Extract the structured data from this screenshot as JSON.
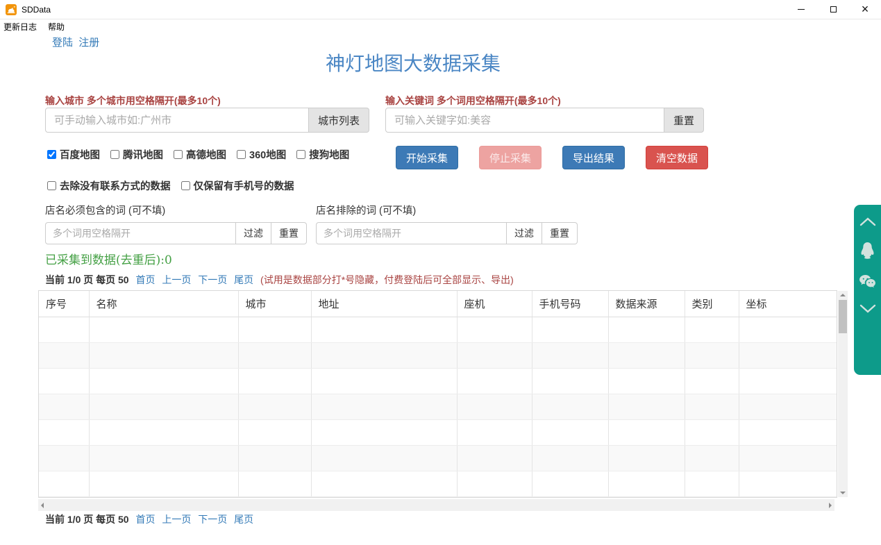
{
  "window": {
    "title": "SDData",
    "menu": [
      "更新日志",
      "帮助"
    ]
  },
  "auth": {
    "login": "登陆",
    "register": "注册"
  },
  "app": {
    "title": "神灯地图大数据采集"
  },
  "city_section": {
    "label": "输入城市 多个城市用空格隔开(最多10个)",
    "placeholder": "可手动输入城市如:广州市",
    "list_button": "城市列表"
  },
  "keyword_section": {
    "label": "输入关键词 多个词用空格隔开(最多10个)",
    "placeholder": "可输入关键字如:美容",
    "reset_button": "重置"
  },
  "map_sources": [
    {
      "label": "百度地图",
      "checked": true
    },
    {
      "label": "腾讯地图",
      "checked": false
    },
    {
      "label": "高德地图",
      "checked": false
    },
    {
      "label": "360地图",
      "checked": false
    },
    {
      "label": "搜狗地图",
      "checked": false
    }
  ],
  "actions": {
    "start": "开始采集",
    "stop": "停止采集",
    "export": "导出结果",
    "clear": "清空数据"
  },
  "record_filters": [
    {
      "label": "去除没有联系方式的数据",
      "checked": false
    },
    {
      "label": "仅保留有手机号的数据",
      "checked": false
    }
  ],
  "include_filter": {
    "label": "店名必须包含的词 (可不填)",
    "placeholder": "多个词用空格隔开",
    "filter_button": "过滤",
    "reset_button": "重置"
  },
  "exclude_filter": {
    "label": "店名排除的词 (可不填)",
    "placeholder": "多个词用空格隔开",
    "filter_button": "过滤",
    "reset_button": "重置"
  },
  "status": {
    "collected_text": "已采集到数据(去重后):0"
  },
  "pagination": {
    "summary": "当前 1/0 页 每页 50",
    "links": [
      "首页",
      "上一页",
      "下一页",
      "尾页"
    ],
    "note": "(试用是数据部分打*号隐藏，付费登陆后可全部显示、导出)"
  },
  "table": {
    "columns": [
      "序号",
      "名称",
      "城市",
      "地址",
      "座机",
      "手机号码",
      "数据来源",
      "类别",
      "坐标"
    ],
    "rows": []
  },
  "window_controls": {
    "minimize": "—",
    "maximize": "",
    "close": "×"
  },
  "colors": {
    "accent_blue": "#337ab7",
    "title_blue": "#4a86c4",
    "primary_btn": "#3d7ab6",
    "danger_red": "#d9534f",
    "label_red": "#a94442",
    "status_green": "#44a044",
    "sidebar_green": "#0d9b8a"
  }
}
